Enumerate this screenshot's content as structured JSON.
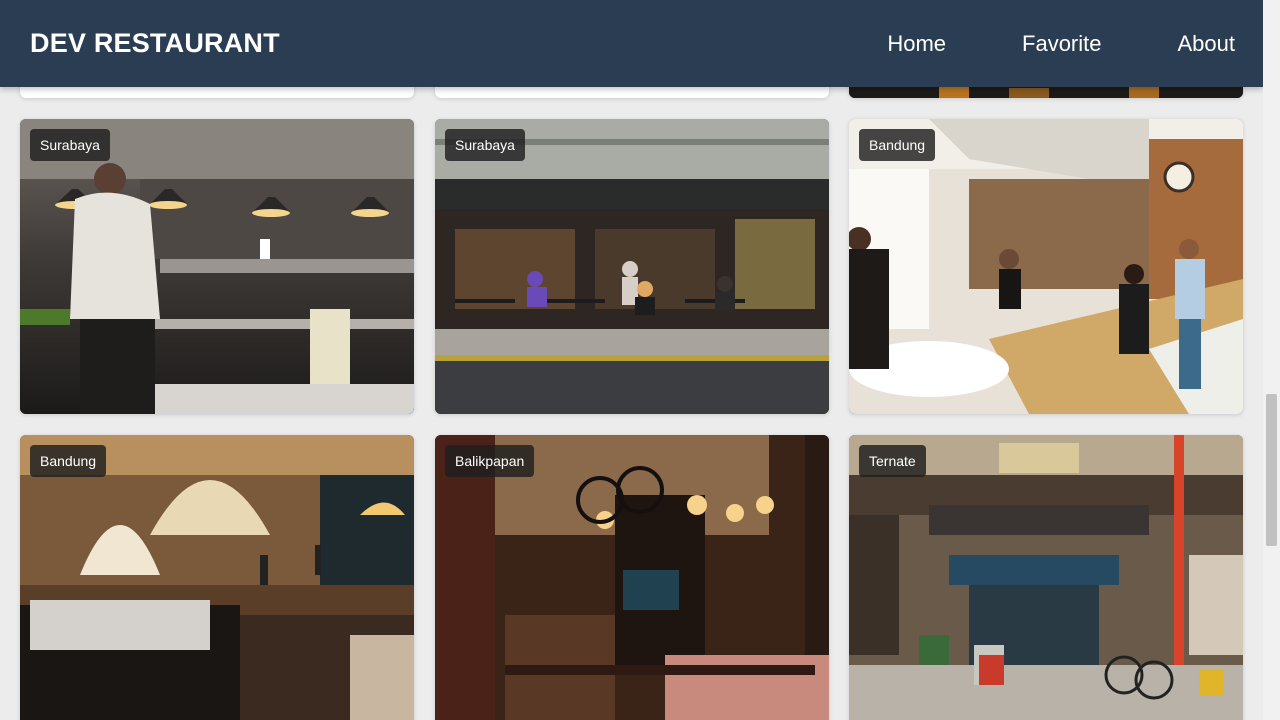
{
  "header": {
    "brand": "DEV RESTAURANT",
    "nav": [
      {
        "label": "Home"
      },
      {
        "label": "Favorite"
      },
      {
        "label": "About"
      }
    ]
  },
  "restaurants": [
    {
      "city": "Surabaya",
      "scene": "kitchen-icon"
    },
    {
      "city": "Surabaya",
      "scene": "street-cafe-icon"
    },
    {
      "city": "Bandung",
      "scene": "coffee-bar-icon"
    },
    {
      "city": "Bandung",
      "scene": "hall-bar-icon"
    },
    {
      "city": "Balikpapan",
      "scene": "pub-interior-icon"
    },
    {
      "city": "Ternate",
      "scene": "shopfront-icon"
    }
  ],
  "colors": {
    "header": "#2b3d52",
    "background": "#ececec",
    "badge": "#1e1e1e"
  }
}
